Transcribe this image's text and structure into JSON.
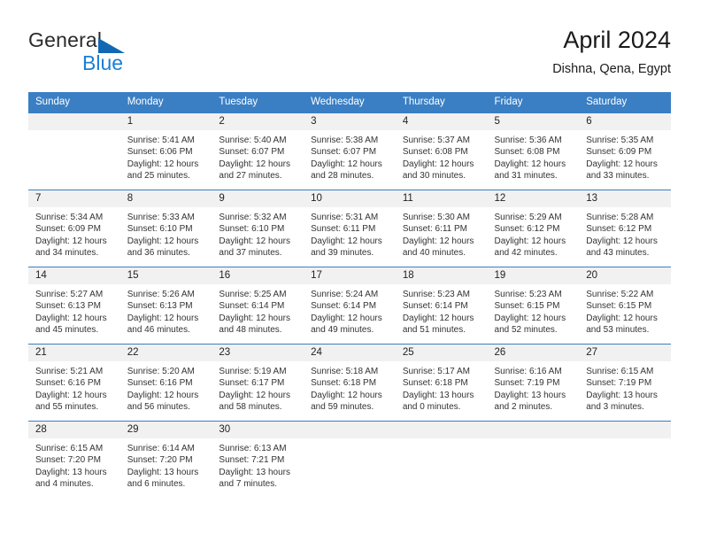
{
  "brand": {
    "line1": "General",
    "line2": "Blue",
    "triangle_color": "#1268b3",
    "blue_color": "#1a7fd4"
  },
  "header": {
    "title": "April 2024",
    "subtitle": "Dishna, Qena, Egypt"
  },
  "theme": {
    "header_blue": "#3a7fc4",
    "daynum_gray": "#f1f1f1"
  },
  "weekdays": [
    "Sunday",
    "Monday",
    "Tuesday",
    "Wednesday",
    "Thursday",
    "Friday",
    "Saturday"
  ],
  "labels": {
    "sunrise": "Sunrise:",
    "sunset": "Sunset:",
    "daylight": "Daylight:"
  },
  "weeks": [
    [
      {
        "day": "",
        "lines": []
      },
      {
        "day": "1",
        "lines": [
          "Sunrise: 5:41 AM",
          "Sunset: 6:06 PM",
          "Daylight: 12 hours",
          "and 25 minutes."
        ]
      },
      {
        "day": "2",
        "lines": [
          "Sunrise: 5:40 AM",
          "Sunset: 6:07 PM",
          "Daylight: 12 hours",
          "and 27 minutes."
        ]
      },
      {
        "day": "3",
        "lines": [
          "Sunrise: 5:38 AM",
          "Sunset: 6:07 PM",
          "Daylight: 12 hours",
          "and 28 minutes."
        ]
      },
      {
        "day": "4",
        "lines": [
          "Sunrise: 5:37 AM",
          "Sunset: 6:08 PM",
          "Daylight: 12 hours",
          "and 30 minutes."
        ]
      },
      {
        "day": "5",
        "lines": [
          "Sunrise: 5:36 AM",
          "Sunset: 6:08 PM",
          "Daylight: 12 hours",
          "and 31 minutes."
        ]
      },
      {
        "day": "6",
        "lines": [
          "Sunrise: 5:35 AM",
          "Sunset: 6:09 PM",
          "Daylight: 12 hours",
          "and 33 minutes."
        ]
      }
    ],
    [
      {
        "day": "7",
        "lines": [
          "Sunrise: 5:34 AM",
          "Sunset: 6:09 PM",
          "Daylight: 12 hours",
          "and 34 minutes."
        ]
      },
      {
        "day": "8",
        "lines": [
          "Sunrise: 5:33 AM",
          "Sunset: 6:10 PM",
          "Daylight: 12 hours",
          "and 36 minutes."
        ]
      },
      {
        "day": "9",
        "lines": [
          "Sunrise: 5:32 AM",
          "Sunset: 6:10 PM",
          "Daylight: 12 hours",
          "and 37 minutes."
        ]
      },
      {
        "day": "10",
        "lines": [
          "Sunrise: 5:31 AM",
          "Sunset: 6:11 PM",
          "Daylight: 12 hours",
          "and 39 minutes."
        ]
      },
      {
        "day": "11",
        "lines": [
          "Sunrise: 5:30 AM",
          "Sunset: 6:11 PM",
          "Daylight: 12 hours",
          "and 40 minutes."
        ]
      },
      {
        "day": "12",
        "lines": [
          "Sunrise: 5:29 AM",
          "Sunset: 6:12 PM",
          "Daylight: 12 hours",
          "and 42 minutes."
        ]
      },
      {
        "day": "13",
        "lines": [
          "Sunrise: 5:28 AM",
          "Sunset: 6:12 PM",
          "Daylight: 12 hours",
          "and 43 minutes."
        ]
      }
    ],
    [
      {
        "day": "14",
        "lines": [
          "Sunrise: 5:27 AM",
          "Sunset: 6:13 PM",
          "Daylight: 12 hours",
          "and 45 minutes."
        ]
      },
      {
        "day": "15",
        "lines": [
          "Sunrise: 5:26 AM",
          "Sunset: 6:13 PM",
          "Daylight: 12 hours",
          "and 46 minutes."
        ]
      },
      {
        "day": "16",
        "lines": [
          "Sunrise: 5:25 AM",
          "Sunset: 6:14 PM",
          "Daylight: 12 hours",
          "and 48 minutes."
        ]
      },
      {
        "day": "17",
        "lines": [
          "Sunrise: 5:24 AM",
          "Sunset: 6:14 PM",
          "Daylight: 12 hours",
          "and 49 minutes."
        ]
      },
      {
        "day": "18",
        "lines": [
          "Sunrise: 5:23 AM",
          "Sunset: 6:14 PM",
          "Daylight: 12 hours",
          "and 51 minutes."
        ]
      },
      {
        "day": "19",
        "lines": [
          "Sunrise: 5:23 AM",
          "Sunset: 6:15 PM",
          "Daylight: 12 hours",
          "and 52 minutes."
        ]
      },
      {
        "day": "20",
        "lines": [
          "Sunrise: 5:22 AM",
          "Sunset: 6:15 PM",
          "Daylight: 12 hours",
          "and 53 minutes."
        ]
      }
    ],
    [
      {
        "day": "21",
        "lines": [
          "Sunrise: 5:21 AM",
          "Sunset: 6:16 PM",
          "Daylight: 12 hours",
          "and 55 minutes."
        ]
      },
      {
        "day": "22",
        "lines": [
          "Sunrise: 5:20 AM",
          "Sunset: 6:16 PM",
          "Daylight: 12 hours",
          "and 56 minutes."
        ]
      },
      {
        "day": "23",
        "lines": [
          "Sunrise: 5:19 AM",
          "Sunset: 6:17 PM",
          "Daylight: 12 hours",
          "and 58 minutes."
        ]
      },
      {
        "day": "24",
        "lines": [
          "Sunrise: 5:18 AM",
          "Sunset: 6:18 PM",
          "Daylight: 12 hours",
          "and 59 minutes."
        ]
      },
      {
        "day": "25",
        "lines": [
          "Sunrise: 5:17 AM",
          "Sunset: 6:18 PM",
          "Daylight: 13 hours",
          "and 0 minutes."
        ]
      },
      {
        "day": "26",
        "lines": [
          "Sunrise: 6:16 AM",
          "Sunset: 7:19 PM",
          "Daylight: 13 hours",
          "and 2 minutes."
        ]
      },
      {
        "day": "27",
        "lines": [
          "Sunrise: 6:15 AM",
          "Sunset: 7:19 PM",
          "Daylight: 13 hours",
          "and 3 minutes."
        ]
      }
    ],
    [
      {
        "day": "28",
        "lines": [
          "Sunrise: 6:15 AM",
          "Sunset: 7:20 PM",
          "Daylight: 13 hours",
          "and 4 minutes."
        ]
      },
      {
        "day": "29",
        "lines": [
          "Sunrise: 6:14 AM",
          "Sunset: 7:20 PM",
          "Daylight: 13 hours",
          "and 6 minutes."
        ]
      },
      {
        "day": "30",
        "lines": [
          "Sunrise: 6:13 AM",
          "Sunset: 7:21 PM",
          "Daylight: 13 hours",
          "and 7 minutes."
        ]
      },
      {
        "day": "",
        "lines": []
      },
      {
        "day": "",
        "lines": []
      },
      {
        "day": "",
        "lines": []
      },
      {
        "day": "",
        "lines": []
      }
    ]
  ]
}
